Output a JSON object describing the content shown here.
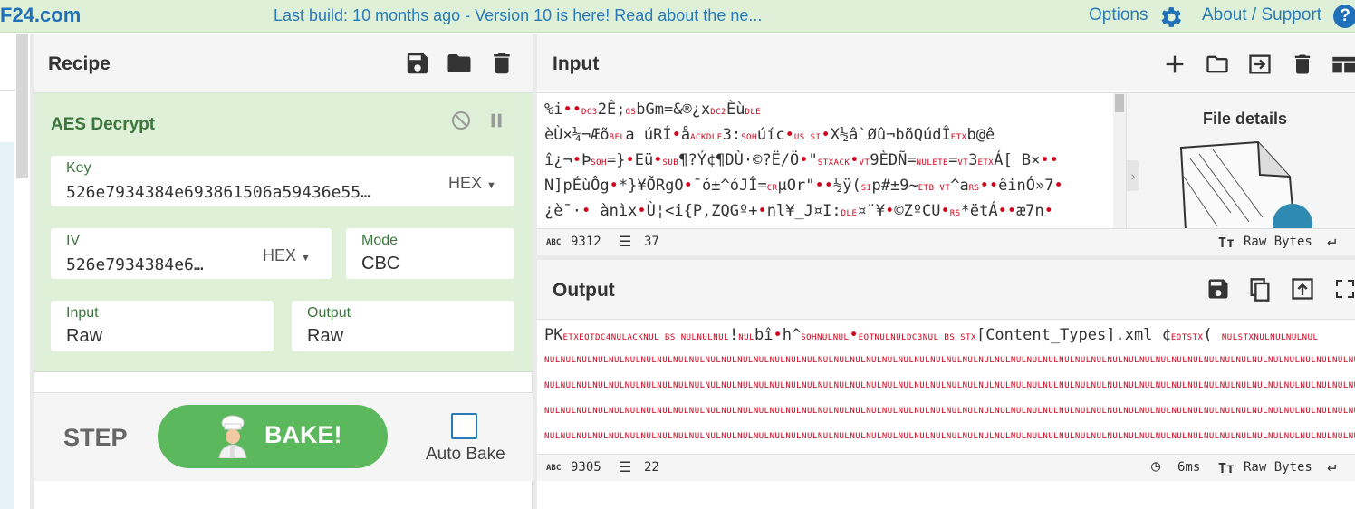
{
  "banner": {
    "logo": "F24.com",
    "message": "Last build: 10 months ago - Version 10 is here! Read about the ne...",
    "options_label": "Options",
    "about_label": "About / Support",
    "help_glyph": "?",
    "accent_color": "#2a7ab8"
  },
  "recipe": {
    "title": "Recipe",
    "icons": [
      "save-icon",
      "folder-icon",
      "trash-icon"
    ],
    "operation": {
      "name": "AES Decrypt",
      "icons": [
        "disable-icon",
        "pause-icon"
      ],
      "key": {
        "label": "Key",
        "value": "526e7934384e693861506a59436e55…",
        "format": "HEX"
      },
      "iv": {
        "label": "IV",
        "value": "526e7934384e6…",
        "format": "HEX"
      },
      "mode": {
        "label": "Mode",
        "value": "CBC"
      },
      "input": {
        "label": "Input",
        "value": "Raw"
      },
      "output": {
        "label": "Output",
        "value": "Raw"
      }
    },
    "step_label": "STEP",
    "bake_label": "BAKE!",
    "auto_bake_label": "Auto Bake",
    "bake_color": "#5cb85c"
  },
  "input": {
    "title": "Input",
    "icons": [
      "plus-icon",
      "folder-icon",
      "import-icon",
      "trash-icon",
      "layout-icon"
    ],
    "lines": [
      [
        [
          "t",
          "%i"
        ],
        [
          "d",
          "••"
        ],
        [
          "c",
          "DC3"
        ],
        [
          "t",
          "2Ê;"
        ],
        [
          "c",
          "GS"
        ],
        [
          "t",
          "bGm=&®¿x"
        ],
        [
          "c",
          "DC2"
        ],
        [
          "t",
          "Èù"
        ],
        [
          "c",
          "DLE"
        ]
      ],
      [
        [
          "t",
          "èÙ×¼¬Æõ"
        ],
        [
          "c",
          "BEL"
        ],
        [
          "t",
          "a úRÍ"
        ],
        [
          "d",
          "•"
        ],
        [
          "t",
          "å"
        ],
        [
          "c",
          "ACKDLE"
        ],
        [
          "t",
          "3:"
        ],
        [
          "c",
          "SOH"
        ],
        [
          "t",
          "úíc"
        ],
        [
          "d",
          "•"
        ],
        [
          "c",
          "US SI"
        ],
        [
          "d",
          "•"
        ],
        [
          "t",
          "X½â`Øû¬bõQúdÎ"
        ],
        [
          "c",
          "ETX"
        ],
        [
          "t",
          "b@ê"
        ]
      ],
      [
        [
          "t",
          "î¿¬"
        ],
        [
          "d",
          "•"
        ],
        [
          "t",
          "Þ"
        ],
        [
          "c",
          "SOH"
        ],
        [
          "t",
          "=}"
        ],
        [
          "d",
          "•"
        ],
        [
          "t",
          "Eü"
        ],
        [
          "d",
          "•"
        ],
        [
          "c",
          "SUB"
        ],
        [
          "t",
          "¶?Ý¢¶DÙ·©?Ë/Ö"
        ],
        [
          "d",
          "•"
        ],
        [
          "t",
          "\""
        ],
        [
          "c",
          "STXACK"
        ],
        [
          "d",
          "•"
        ],
        [
          "c",
          "VT"
        ],
        [
          "t",
          "9ÈDÑ="
        ],
        [
          "c",
          "NULETB"
        ],
        [
          "t",
          "="
        ],
        [
          "c",
          "VT"
        ],
        [
          "t",
          "3"
        ],
        [
          "c",
          "ETX"
        ],
        [
          "t",
          "Á[ B×"
        ],
        [
          "d",
          "••"
        ]
      ],
      [
        [
          "t",
          "N]pÉùÔg"
        ],
        [
          "d",
          "•"
        ],
        [
          "t",
          "*}¥ÕRgO"
        ],
        [
          "d",
          "•"
        ],
        [
          "t",
          "¯ó±^óJÎ="
        ],
        [
          "c",
          "CR"
        ],
        [
          "t",
          "µOr\""
        ],
        [
          "d",
          "••"
        ],
        [
          "t",
          "½ÿ("
        ],
        [
          "c",
          "SI"
        ],
        [
          "t",
          "p#±9~"
        ],
        [
          "c",
          "ETB VT"
        ],
        [
          "t",
          "^a"
        ],
        [
          "c",
          "RS"
        ],
        [
          "d",
          "••"
        ],
        [
          "t",
          "êinÓ»7"
        ],
        [
          "d",
          "•"
        ]
      ],
      [
        [
          "t",
          "¿è¯·"
        ],
        [
          "d",
          "•"
        ],
        [
          "t",
          "   ànìx"
        ],
        [
          "d",
          "•"
        ],
        [
          "t",
          "Ù¦<i{P,ZQGº+"
        ],
        [
          "d",
          "•"
        ],
        [
          "t",
          "nl¥_J¤I:"
        ],
        [
          "c",
          "DLE"
        ],
        [
          "t",
          "¤¨¥"
        ],
        [
          "d",
          "•"
        ],
        [
          "t",
          "©ZºCU"
        ],
        [
          "d",
          "•"
        ],
        [
          "c",
          "RS"
        ],
        [
          "t",
          "*ëtÁ"
        ],
        [
          "d",
          "••"
        ],
        [
          "t",
          "æ7n"
        ],
        [
          "d",
          "•"
        ]
      ]
    ],
    "length": "9312",
    "lines_count": "37",
    "raw_bytes_label": "Raw Bytes"
  },
  "file_details": {
    "title": "File details"
  },
  "output": {
    "title": "Output",
    "icons": [
      "save-icon",
      "copy-icon",
      "replace-input-icon",
      "maximise-icon"
    ],
    "first_line": [
      [
        "t",
        "PK"
      ],
      [
        "c",
        "ETXEOTDC4NULACKNUL BS NULNULNUL"
      ],
      [
        "t",
        "!"
      ],
      [
        "c",
        "NUL"
      ],
      [
        "t",
        "bî"
      ],
      [
        "d",
        "•"
      ],
      [
        "t",
        "h^"
      ],
      [
        "c",
        "SOHNULNUL"
      ],
      [
        "d",
        "•"
      ],
      [
        "c",
        "EOTNULNULDC3NUL BS STX"
      ],
      [
        "t",
        "[Content_Types].xml ¢"
      ],
      [
        "c",
        "EOTSTX"
      ],
      [
        "t",
        "( "
      ],
      [
        "c",
        "NULSTXNULNULNULNUL"
      ]
    ],
    "null_line": "NULNULNULNULNULNULNULNULNULNULNULNULNULNULNULNULNULNULNULNULNULNULNULNULNULNULNULNULNULNULNULNULNULNULNULNULNULNULNULNULNULNULNULNULNULNULNULNULNULNULNUL",
    "length": "9305",
    "lines_count": "22",
    "time": "6ms",
    "raw_bytes_label": "Raw Bytes",
    "ctl_color": "#d0021b"
  }
}
